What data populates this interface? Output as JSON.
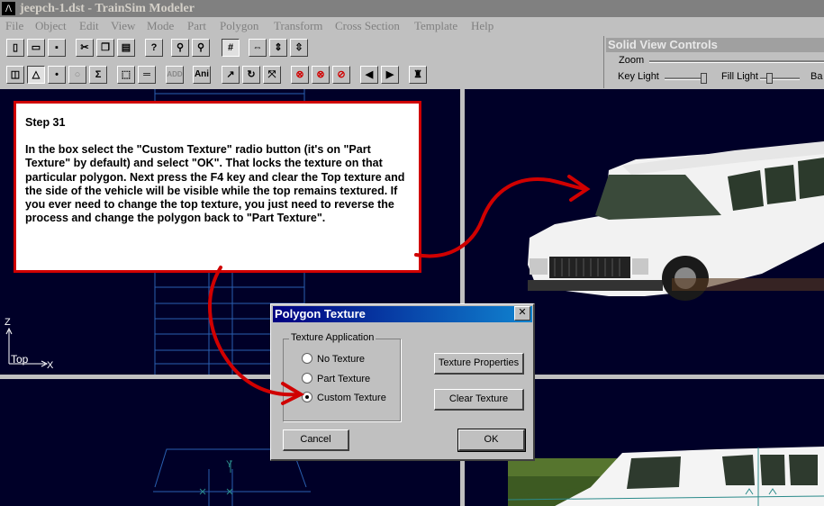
{
  "window": {
    "title": "jeepch-1.dst - TrainSim Modeler"
  },
  "menu": [
    "File",
    "Object",
    "Edit",
    "View",
    "Mode",
    "Part",
    "Polygon",
    "Transform",
    "Cross Section",
    "Template",
    "Help"
  ],
  "toolbar": {
    "ani_label": "Ani",
    "add_label": "ADD"
  },
  "solid_view_controls": {
    "title": "Solid View Controls",
    "zoom_label": "Zoom",
    "key_light_label": "Key Light",
    "fill_light_label": "Fill Light",
    "back_label": "Ba"
  },
  "viewport": {
    "z_axis": "Z",
    "x_axis": "X",
    "view_name": "Top",
    "y_axis": "Y"
  },
  "note": {
    "title": "Step 31",
    "body": "In the box select the \"Custom Texture\"  radio button (it's on \"Part Texture\" by default) and select \"OK\". That locks the texture on that particular polygon. Next press the F4 key and clear the Top texture and the side of the vehicle will be visible while the top remains textured. If you ever need to change the top texture, you just need to reverse the process and change the polygon back to \"Part Texture\"."
  },
  "dialog": {
    "title": "Polygon Texture",
    "close_label": "✕",
    "group_label": "Texture Application",
    "options": [
      "No Texture",
      "Part Texture",
      "Custom Texture"
    ],
    "selected_option": "Custom Texture",
    "texture_properties_label": "Texture Properties",
    "clear_texture_label": "Clear Texture",
    "cancel_label": "Cancel",
    "ok_label": "OK"
  },
  "colors": {
    "annotation_red": "#d00000",
    "viewport_bg": "#000028",
    "wire_blue": "#2a5fb0"
  }
}
